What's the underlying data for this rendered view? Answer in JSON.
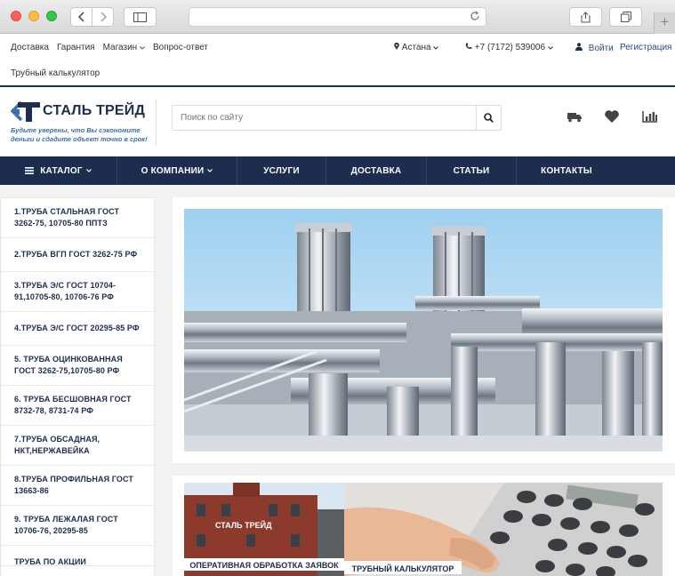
{
  "top_links": [
    "Доставка",
    "Гарантия",
    "Магазин",
    "Вопрос-ответ"
  ],
  "calc_link": "Трубный калькулятор",
  "city": "Астана",
  "phone": "+7 (7172) 539006",
  "login": "Войти",
  "register": "Регистрация",
  "logo": {
    "text": "СТАЛЬ ТРЕЙД",
    "slogan": "Будьте уверены, что Вы сэкономите деньги и сдадите объект точно в срок!"
  },
  "search": {
    "placeholder": "Поиск по сайту"
  },
  "nav": {
    "catalog": "КАТАЛОГ",
    "about": "О КОМПАНИИ",
    "services": "УСЛУГИ",
    "delivery": "ДОСТАВКА",
    "articles": "СТАТЬИ",
    "contacts": "КОНТАКТЫ"
  },
  "menu": [
    "1.ТРУБА СТАЛЬНАЯ ГОСТ 3262-75, 10705-80 ППТЗ",
    "2.ТРУБА ВГП ГОСТ 3262-75 РФ",
    "3.ТРУБА Э/С ГОСТ 10704-91,10705-80, 10706-76 РФ",
    "4.ТРУБА Э/С ГОСТ 20295-85 РФ",
    "5. ТРУБА ОЦИНКОВАННАЯ ГОСТ 3262-75,10705-80 РФ",
    "6. ТРУБА БЕСШОВНАЯ ГОСТ 8732-78, 8731-74 РФ",
    "7.ТРУБА ОБСАДНАЯ, НКТ,НЕРЖАВЕЙКА",
    "8.ТРУБА ПРОФИЛЬНАЯ ГОСТ 13663-86",
    "9. ТРУБА ЛЕЖАЛАЯ ГОСТ 10706-76, 20295-85",
    "ТРУБА ПО АКЦИИ"
  ],
  "promos": {
    "first": "ОПЕРАТИВНАЯ ОБРАБОТКА ЗАЯВОК",
    "second": "ТРУБНЫЙ КАЛЬКУЛЯТОР",
    "building_sign": "СТАЛЬ ТРЕЙД"
  },
  "colors": {
    "brand_navy": "#1d2d50",
    "slogan_blue": "#3a6fb0",
    "background": "#f2f2f2"
  },
  "icons": [
    "back-arrow-icon",
    "forward-arrow-icon",
    "sidebar-icon",
    "reload-icon",
    "share-icon",
    "tabs-icon",
    "plus-icon",
    "location-pin-icon",
    "phone-icon",
    "user-icon",
    "search-icon",
    "truck-icon",
    "heart-icon",
    "bar-chart-icon",
    "hamburger-icon",
    "chevron-down-icon"
  ]
}
